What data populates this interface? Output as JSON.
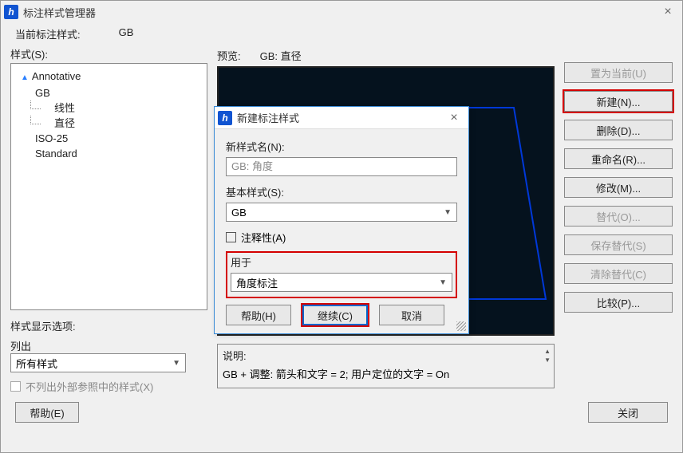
{
  "window": {
    "title": "标注样式管理器"
  },
  "current_style": {
    "label": "当前标注样式:",
    "value": "GB"
  },
  "styles_label": "样式(S):",
  "tree": {
    "root": "Annotative",
    "gb": "GB",
    "gb_children": [
      "线性",
      "直径"
    ],
    "iso": "ISO-25",
    "std": "Standard"
  },
  "display_opts": {
    "label": "样式显示选项:",
    "list_label": "列出",
    "combo": "所有样式",
    "checkbox": "不列出外部参照中的样式(X)"
  },
  "preview": {
    "label": "预览:",
    "current": "GB: 直径"
  },
  "desc": {
    "label": "说明:",
    "text": "GB + 调整: 箭头和文字 = 2; 用户定位的文字 = On"
  },
  "buttons": {
    "set_current": "置为当前(U)",
    "new": "新建(N)...",
    "delete": "删除(D)...",
    "rename": "重命名(R)...",
    "modify": "修改(M)...",
    "override": "替代(O)...",
    "save_override": "保存替代(S)",
    "clear_override": "清除替代(C)",
    "compare": "比较(P)...",
    "help": "帮助(E)",
    "close": "关闭"
  },
  "modal": {
    "title": "新建标注样式",
    "new_name_label": "新样式名(N):",
    "new_name_value": "GB: 角度",
    "base_label": "基本样式(S):",
    "base_value": "GB",
    "annotative": "注释性(A)",
    "use_for_label": "用于",
    "use_for_value": "角度标注",
    "help": "帮助(H)",
    "continue": "继续(C)",
    "cancel": "取消"
  }
}
